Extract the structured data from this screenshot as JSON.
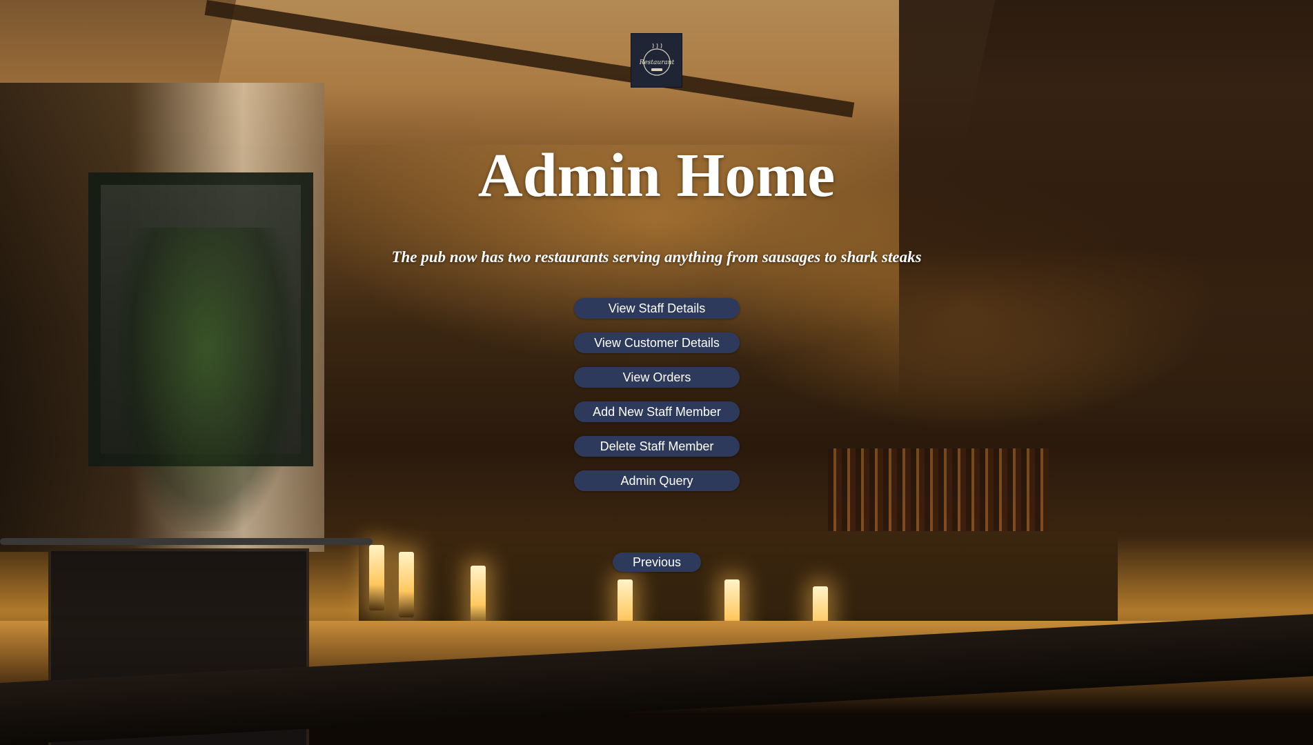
{
  "header": {
    "logo_icon": "restaurant-logo-icon",
    "logo_text": "Restaurant",
    "title": "Admin Home",
    "tagline": "The pub now has two restaurants serving anything from sausages to shark steaks"
  },
  "menu": {
    "items": [
      {
        "label": "View Staff Details"
      },
      {
        "label": "View Customer Details"
      },
      {
        "label": "View Orders"
      },
      {
        "label": "Add New Staff Member"
      },
      {
        "label": "Delete Staff Member"
      },
      {
        "label": "Admin Query"
      }
    ]
  },
  "navigation": {
    "previous_label": "Previous"
  },
  "colors": {
    "button_background": "#2e3a5b",
    "button_text": "#ffffff",
    "title_text": "#ffffff",
    "logo_background": "#1f2535"
  }
}
